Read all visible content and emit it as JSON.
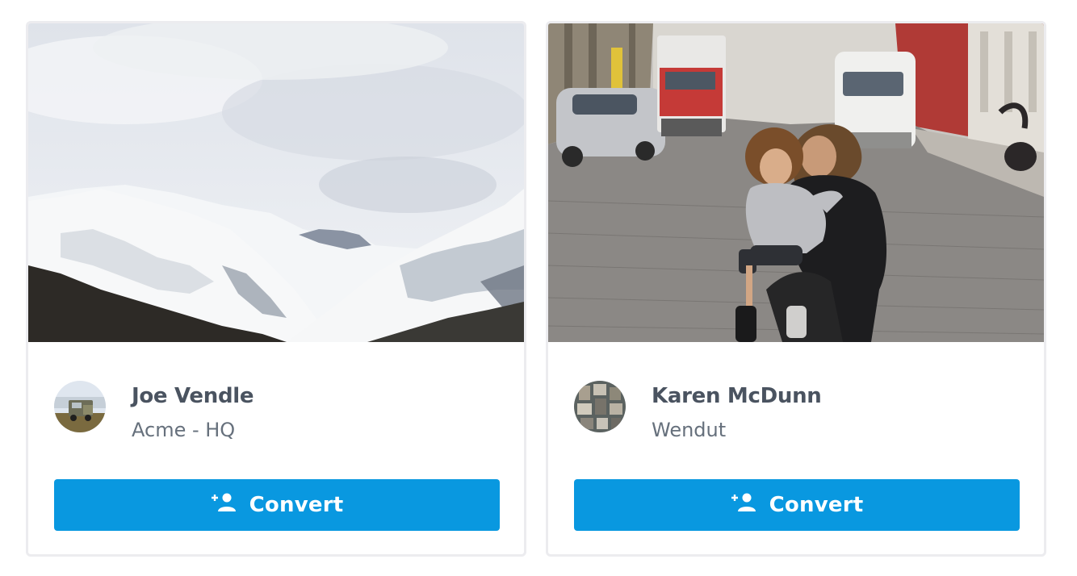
{
  "cards": [
    {
      "image_alt": "snowy-mountains",
      "avatar_alt": "truck",
      "name": "Joe Vendle",
      "org": "Acme - HQ",
      "button_label": "Convert",
      "button_icon": "person-add-icon"
    },
    {
      "image_alt": "mother-and-child-on-street",
      "avatar_alt": "aerial-city",
      "name": "Karen McDunn",
      "org": "Wendut",
      "button_label": "Convert",
      "button_icon": "person-add-icon"
    }
  ],
  "colors": {
    "button": "#0998e0",
    "name_text": "#4a5360",
    "org_text": "#66707c",
    "card_border": "#ececef"
  }
}
